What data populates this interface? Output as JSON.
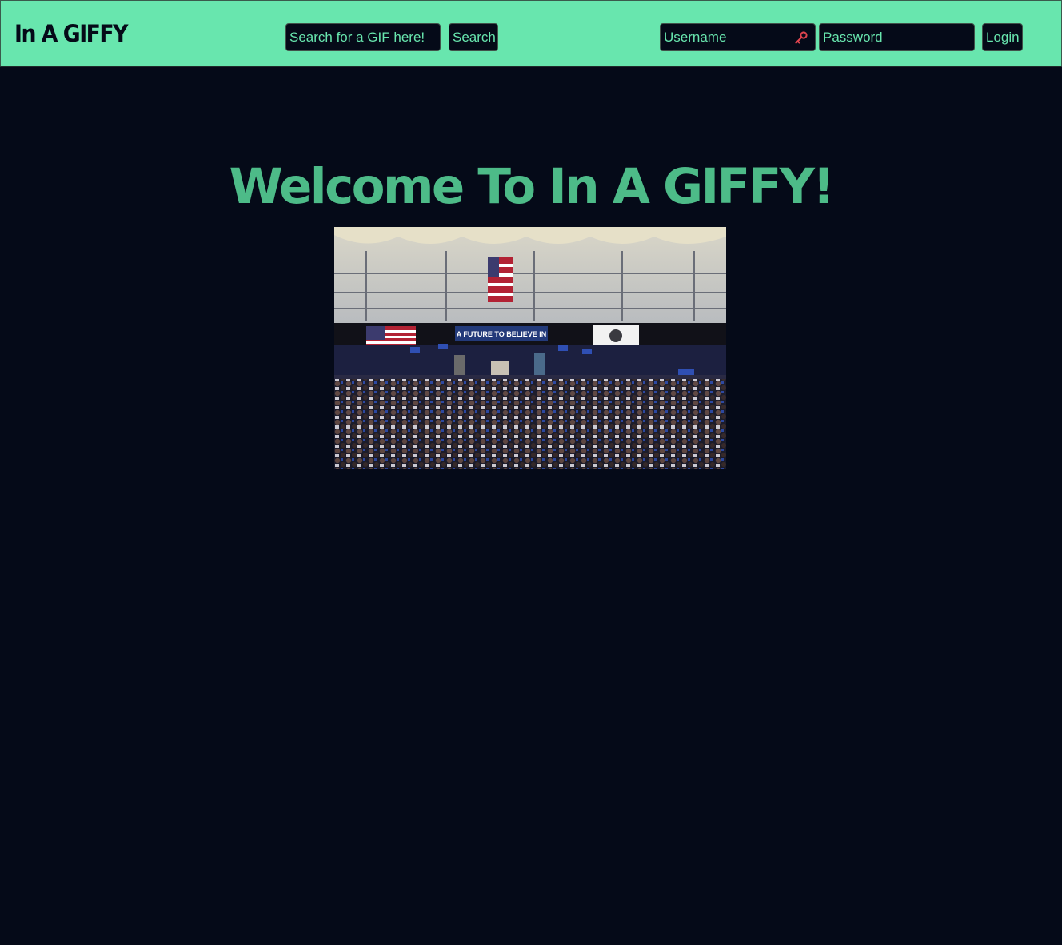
{
  "navbar": {
    "brand": "In A GIFFY",
    "search_placeholder": "Search for a GIF here!",
    "search_button": "Search",
    "username_placeholder": "Username",
    "password_placeholder": "Password",
    "login_button": "Login"
  },
  "main": {
    "welcome_title": "Welcome To In A GIFFY!",
    "gif": {
      "banner_text": "A FUTURE TO BELIEVE IN",
      "icon": "rally-crowd-gif"
    }
  },
  "colors": {
    "accent": "#68e6ae",
    "heading": "#4dbb88",
    "background": "#050a18",
    "key_icon": "#e0454f"
  }
}
